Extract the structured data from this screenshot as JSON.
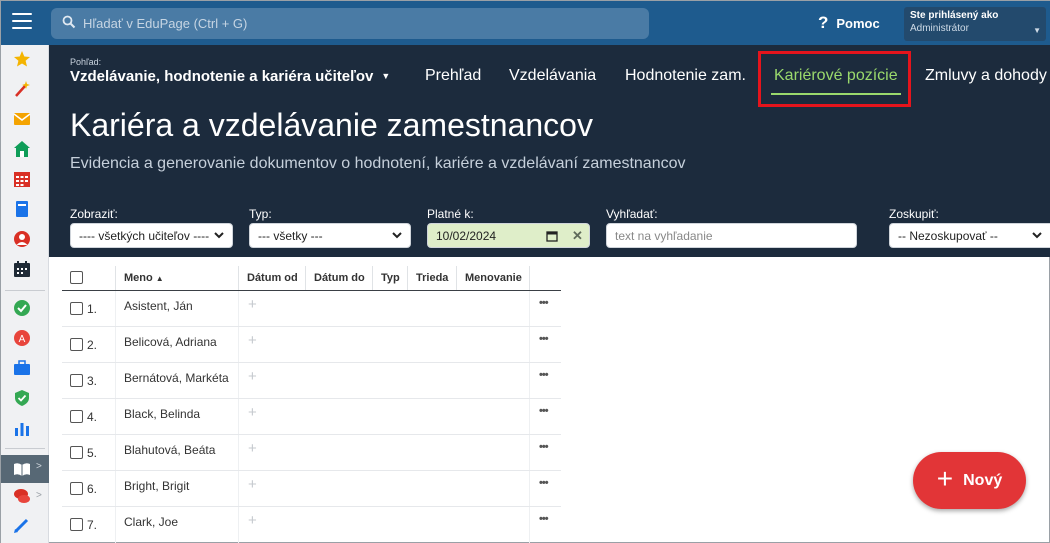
{
  "search": {
    "placeholder": "Hľadať v EduPage (Ctrl + G)"
  },
  "help": {
    "label": "Pomoc"
  },
  "user": {
    "line1": "Ste prihlásený ako",
    "line2": "Administrátor"
  },
  "view": {
    "label": "Pohľad:",
    "value": "Vzdelávanie, hodnotenie a kariéra učiteľov"
  },
  "tabs": [
    {
      "label": "Prehľad"
    },
    {
      "label": "Vzdelávania"
    },
    {
      "label": "Hodnotenie zam."
    },
    {
      "label": "Kariérové pozície",
      "active": true
    },
    {
      "label": "Zmluvy a dohody"
    }
  ],
  "page": {
    "title": "Kariéra a vzdelávanie zamestnancov",
    "subtitle": "Evidencia a generovanie dokumentov o hodnotení, kariére a vzdelávaní zamestnancov"
  },
  "filters": {
    "show": {
      "label": "Zobraziť:",
      "value": "---- všetkých učiteľov ----"
    },
    "type": {
      "label": "Typ:",
      "value": "--- všetky ---"
    },
    "valid": {
      "label": "Platné k:",
      "value": "10/02/2024"
    },
    "search": {
      "label": "Vyhľadať:",
      "placeholder": "text na vyhľadanie"
    },
    "group": {
      "label": "Zoskupiť:",
      "value": "-- Nezoskupovať --"
    }
  },
  "table": {
    "columns": [
      "Meno",
      "Dátum od",
      "Dátum do",
      "Typ",
      "Trieda",
      "Menovanie"
    ],
    "rows": [
      {
        "num": "1.",
        "name": "Asistent, Ján"
      },
      {
        "num": "2.",
        "name": "Belicová, Adriana"
      },
      {
        "num": "3.",
        "name": "Bernátová, Markéta"
      },
      {
        "num": "4.",
        "name": "Black, Belinda"
      },
      {
        "num": "5.",
        "name": "Blahutová, Beáta"
      },
      {
        "num": "6.",
        "name": "Bright, Brigit"
      },
      {
        "num": "7.",
        "name": "Clark, Joe"
      }
    ]
  },
  "new_button": {
    "label": "Nový"
  },
  "colors": {
    "topbar": "#1e5b8e",
    "header": "#1c2b3d",
    "active_tab": "#9ad96c",
    "highlight": "#e5141c",
    "new_button": "#e23537"
  }
}
